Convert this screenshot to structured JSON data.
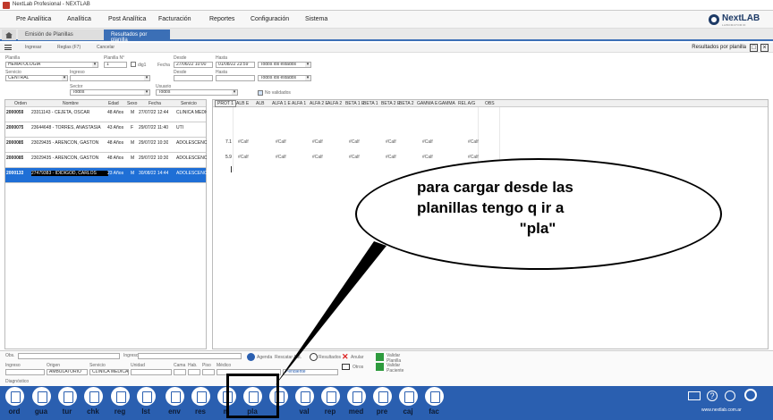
{
  "window": {
    "title": "NextLab Profesional - NEXTLAB"
  },
  "menu": {
    "items": [
      "Pre Analítica",
      "Analítica",
      "Post Analítica",
      "Facturación",
      "Reportes",
      "Configuración",
      "Sistema"
    ],
    "brand": "NextLAB",
    "brand_sub": "LABORATORIO"
  },
  "tabs": {
    "inactive": "Emisión de Planillas",
    "active": "Resultados por planilla"
  },
  "toolbar": {
    "items": [
      "Ingresar",
      "Reglas (F7)",
      "Cancelar"
    ],
    "panel_title": "Resultados por planilla"
  },
  "filters": {
    "planilla_label": "Planilla",
    "planilla_value": "HEMATOLOGIA",
    "planilla_n_label": "Planilla N°",
    "planilla_n_value": "1",
    "dig_label": "dig1",
    "fecha_label": "Fecha",
    "desde_label": "Desde",
    "desde_value": "27/06/22 10:00",
    "hasta_label": "Hasta",
    "hasta_value": "01/08/22 23:59",
    "estados1": "Todos los estados",
    "servicio_label": "Servicio",
    "servicio_value": "CENTRAL",
    "ingreso_label": "Ingreso",
    "desde2_label": "Desde",
    "hasta2_label": "Hasta",
    "estados2": "Todos los estados",
    "sector_label": "Sector",
    "sector_value": "Todos",
    "usuario_label": "Usuario",
    "usuario_value": "Todos",
    "no_validados": "No validados"
  },
  "left_table": {
    "headers": [
      "Orden",
      "Nombre",
      "Edad",
      "Sexo",
      "Fecha",
      "Servicio"
    ],
    "rows": [
      {
        "orden": "2000059",
        "nombre": "23311143 - CEJETA, OSCAR",
        "edad": "48 Años",
        "sexo": "M",
        "fecha": "27/07/22 12:44",
        "servicio": "CLINICA MEDICA"
      },
      {
        "orden": "2000075",
        "nombre": "23644648 - TORRES, ANASTASIA",
        "edad": "43 Años",
        "sexo": "F",
        "fecha": "29/07/22 11:40",
        "servicio": "UTI"
      },
      {
        "orden": "2000085",
        "nombre": "23029435 - ARENCON, GASTON",
        "edad": "48 Años",
        "sexo": "M",
        "fecha": "29/07/22 10:30",
        "servicio": "ADOLESCENCIA"
      },
      {
        "orden": "2000085",
        "nombre": "23029435 - ARENCON, GASTON",
        "edad": "48 Años",
        "sexo": "M",
        "fecha": "29/07/22 10:30",
        "servicio": "ADOLESCENCIA"
      },
      {
        "orden": "2000133",
        "nombre": "27479383 - IDIDIGOD, CARLOS",
        "edad": "23 Años",
        "sexo": "M",
        "fecha": "30/08/22 14:44",
        "servicio": "ADOLESCENCIA"
      }
    ]
  },
  "right_table": {
    "headers": [
      "PROT 1",
      "ALB E",
      "ALB",
      "ALFA 1 E",
      "ALFA 1",
      "ALFA 2 E",
      "ALFA 2",
      "BETA 1 E",
      "BETA 1",
      "BETA 2 E",
      "BETA 2",
      "GAMMA E",
      "GAMMA",
      "REL A/G",
      "OBS"
    ],
    "rows": [
      {
        "prot": "7.1",
        "vals": [
          "#Calf",
          "#Calf",
          "#Calf",
          "#Calf",
          "#Calf",
          "#Calf",
          "#Calf"
        ]
      },
      {
        "prot": "5.9",
        "vals": [
          "#Calf",
          "#Calf",
          "#Calf",
          "#Calf",
          "#Calf",
          "#Calf",
          "#Calf"
        ]
      }
    ]
  },
  "bottom_form": {
    "labels": [
      "Obs.",
      "Ingreso",
      "Ingreso",
      "Origen",
      "Servicio",
      "Unidad",
      "Cama",
      "Hab.",
      "Piso",
      "Médico",
      "Diagnóstico"
    ],
    "origen": "AMBULATORIO",
    "servicio": "CLINICA MEDICA",
    "estado": "Pendiente",
    "buttons": [
      "Agenda",
      "Rescatar Aut.",
      "Resultados",
      "Anular",
      "Validar Planilla",
      "Otros",
      "Validar Paciente"
    ]
  },
  "taskbar": {
    "buttons": [
      "ord",
      "gua",
      "tur",
      "chk",
      "reg",
      "lst",
      "env",
      "res",
      "m",
      "pla",
      "",
      "val",
      "rep",
      "med",
      "pre",
      "caj",
      "fac"
    ],
    "footer": "www.nextlab.com.ar"
  },
  "annotation": {
    "line1": "para cargar desde las",
    "line2": "planillas tengo q ir a",
    "line3": "\"pla\""
  }
}
